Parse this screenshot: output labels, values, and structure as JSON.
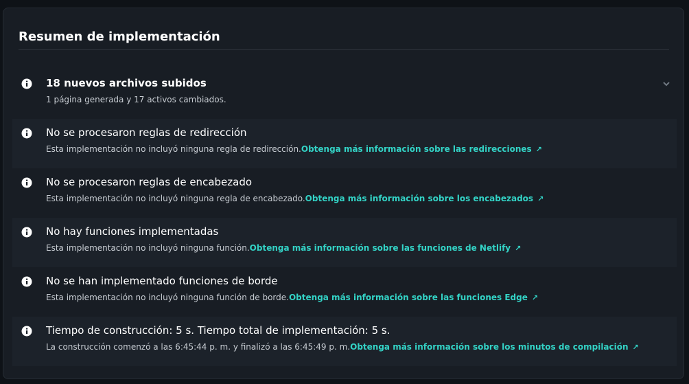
{
  "panel": {
    "title": "Resumen de implementación"
  },
  "colors": {
    "background": "#0e1217",
    "panel": "#181d24",
    "row_alt": "#1c222a",
    "link": "#33d3c6",
    "text": "#ffffff",
    "muted": "#c7ccd2"
  },
  "items": [
    {
      "icon": "info-icon",
      "title": "18 nuevos archivos subidos",
      "description": "1 página generada y 17 activos cambiados.",
      "link": "",
      "expandable": true
    },
    {
      "icon": "info-icon",
      "title": "No se procesaron reglas de redirección",
      "description": "Esta implementación no incluyó ninguna regla de redirección.",
      "link": "Obtenga más información sobre las redirecciones"
    },
    {
      "icon": "info-icon",
      "title": "No se procesaron reglas de encabezado",
      "description": "Esta implementación no incluyó ninguna regla de encabezado.",
      "link": "Obtenga más información sobre los encabezados"
    },
    {
      "icon": "info-icon",
      "title": "No hay funciones implementadas",
      "description": "Esta implementación no incluyó ninguna función.",
      "link": "Obtenga más información sobre las funciones de Netlify"
    },
    {
      "icon": "info-icon",
      "title": "No se han implementado funciones de borde",
      "description": "Esta implementación no incluyó ninguna función de borde.",
      "link": "Obtenga más información sobre las funciones Edge"
    },
    {
      "icon": "info-icon",
      "title": "Tiempo de construcción: 5 s. Tiempo total de implementación: 5 s.",
      "description": "La construcción comenzó a las 6:45:44 p. m. y finalizó a las 6:45:49 p. m.",
      "link": "Obtenga más información sobre los minutos de compilación"
    }
  ]
}
